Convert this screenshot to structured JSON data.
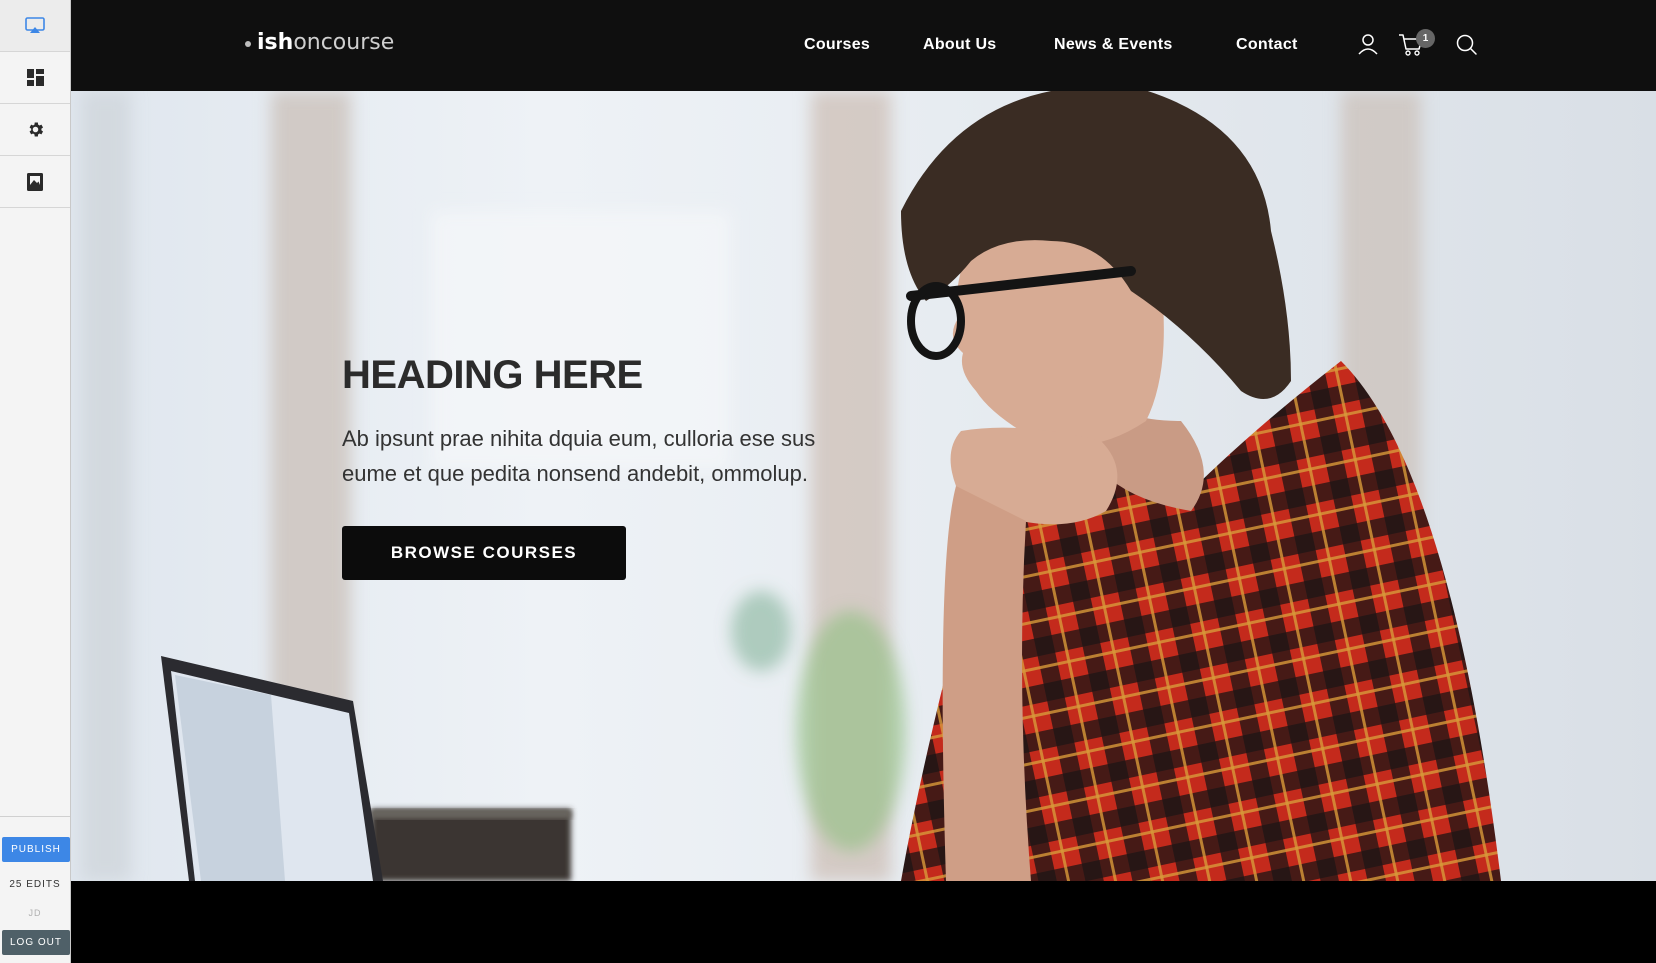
{
  "sidebar": {
    "items": [
      {
        "icon": "airplay-icon"
      },
      {
        "icon": "dashboard-icon"
      },
      {
        "icon": "gear-icon"
      },
      {
        "icon": "image-icon"
      }
    ],
    "publish_label": "PUBLISH",
    "edits_label": "25 EDITS",
    "user_initials": "JD",
    "logout_label": "LOG OUT"
  },
  "header": {
    "logo": {
      "part1": "ish",
      "part2": "oncourse"
    },
    "nav": [
      "Courses",
      "About Us",
      "News & Events",
      "Contact"
    ],
    "icons": [
      "user-icon",
      "cart-icon",
      "search-icon"
    ],
    "cart_count": "1"
  },
  "hero": {
    "heading": "HEADING HERE",
    "text": "Ab ipsunt prae nihita dquia eum, culloria ese sus eume et que pedita nonsend andebit, ommolup.",
    "button_label": "BROWSE COURSES"
  },
  "colors": {
    "accent_blue": "#3d87e6",
    "logout_gray": "#4f6068",
    "header_bg": "#0f0f0f",
    "button_black": "#0c0c0c",
    "shirt_red": "#c42a1c"
  }
}
